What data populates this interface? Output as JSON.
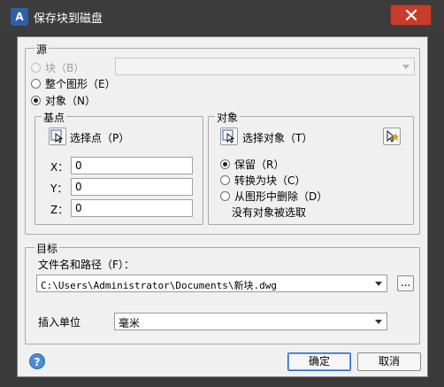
{
  "window": {
    "title": "保存块到磁盘",
    "app_icon": "acad-icon"
  },
  "source": {
    "group_title": "源",
    "block_label": "块（B）",
    "entire_label": "整个图形（E）",
    "objects_label": "对象（N）",
    "selected": "objects",
    "block_combo_value": ""
  },
  "base_point": {
    "group_title": "基点",
    "pick_label": "选择点（P）",
    "x_label": "X：",
    "y_label": "Y：",
    "z_label": "Z：",
    "x_value": "0",
    "y_value": "0",
    "z_value": "0"
  },
  "objects": {
    "group_title": "对象",
    "select_label": "选择对象（T）",
    "retain_label": "保留（R）",
    "convert_label": "转换为块（C）",
    "delete_label": "从图形中删除（D）",
    "selected": "retain",
    "status": "没有对象被选取"
  },
  "destination": {
    "group_title": "目标",
    "path_label": "文件名和路径（F）：",
    "path_value": "C:\\Users\\Administrator\\Documents\\新块.dwg",
    "browse_label": "...",
    "units_label": "插入单位",
    "units_value": "毫米"
  },
  "buttons": {
    "ok": "确定",
    "cancel": "取消",
    "help": "?"
  }
}
